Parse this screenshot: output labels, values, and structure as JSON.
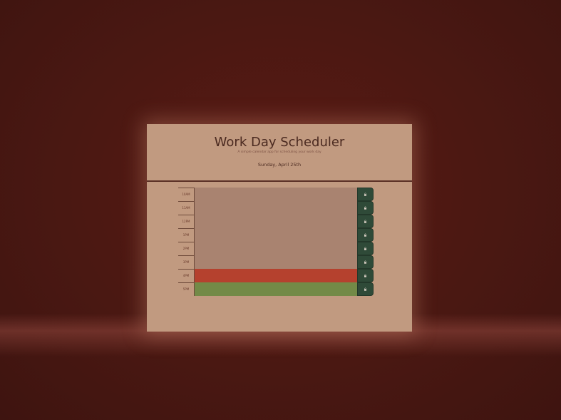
{
  "header": {
    "title": "Work Day Scheduler",
    "subtitle": "A simple calendar app for scheduling your work day",
    "current_date": "Sunday, April 25th"
  },
  "colors": {
    "background": "#4a1812",
    "panel": "#c19a80",
    "past": "#a98370",
    "present": "#b5412e",
    "future": "#738a47",
    "save_button": "#2f4a38"
  },
  "time_blocks": [
    {
      "hour": "10AM",
      "text": "",
      "state": "past",
      "save_icon": "lock-icon"
    },
    {
      "hour": "11AM",
      "text": "",
      "state": "past",
      "save_icon": "lock-icon"
    },
    {
      "hour": "12PM",
      "text": "",
      "state": "past",
      "save_icon": "lock-icon"
    },
    {
      "hour": "1PM",
      "text": "",
      "state": "past",
      "save_icon": "lock-icon"
    },
    {
      "hour": "2PM",
      "text": "",
      "state": "past",
      "save_icon": "lock-icon"
    },
    {
      "hour": "3PM",
      "text": "",
      "state": "past",
      "save_icon": "lock-icon"
    },
    {
      "hour": "4PM",
      "text": "",
      "state": "present",
      "save_icon": "lock-icon"
    },
    {
      "hour": "5PM",
      "text": "",
      "state": "future",
      "save_icon": "lock-icon"
    }
  ]
}
